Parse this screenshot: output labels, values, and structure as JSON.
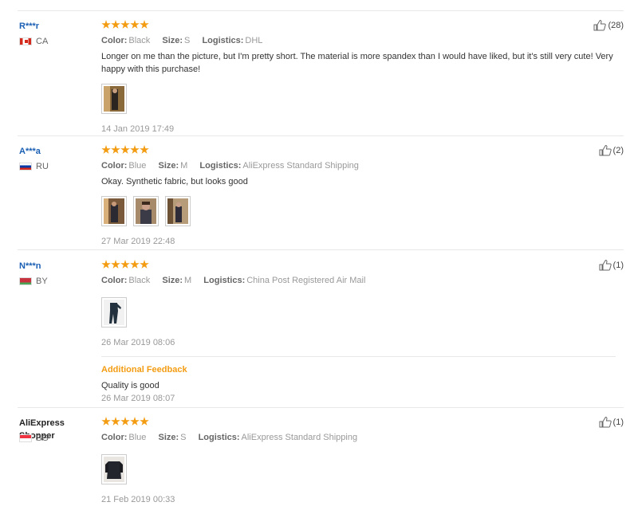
{
  "labels": {
    "color": "Color:",
    "size": "Size:",
    "logistics": "Logistics:",
    "additional_feedback": "Additional Feedback"
  },
  "colors": {
    "star": "#f39c12",
    "username": "#1a5fb4",
    "accent": "#f39c12"
  },
  "reviews": [
    {
      "user": "R***r",
      "country": "CA",
      "stars": 5,
      "color": "Black",
      "size": "S",
      "logistics": "DHL",
      "text": "Longer on me than the picture, but I'm pretty short. The material is more spandex than I would have liked, but it's still very cute! Very happy with this purchase!",
      "date": "14 Jan 2019 17:49",
      "likes": "(28)"
    },
    {
      "user": "A***a",
      "country": "RU",
      "stars": 5,
      "color": "Blue",
      "size": "M",
      "logistics": "AliExpress Standard Shipping",
      "text": "Okay. Synthetic fabric, but looks good",
      "date": "27 Mar 2019 22:48",
      "likes": "(2)"
    },
    {
      "user": "N***n",
      "country": "BY",
      "stars": 5,
      "color": "Black",
      "size": "M",
      "logistics": "China Post Registered Air Mail",
      "date": "26 Mar 2019 08:06",
      "likes": "(1)",
      "additional_text": "Quality is good",
      "additional_date": "26 Mar 2019 08:07"
    },
    {
      "user": "AliExpress Shopper",
      "country": "SG",
      "stars": 5,
      "color": "Blue",
      "size": "S",
      "logistics": "AliExpress Standard Shipping",
      "date": "21 Feb 2019 00:33",
      "likes": "(1)"
    }
  ]
}
